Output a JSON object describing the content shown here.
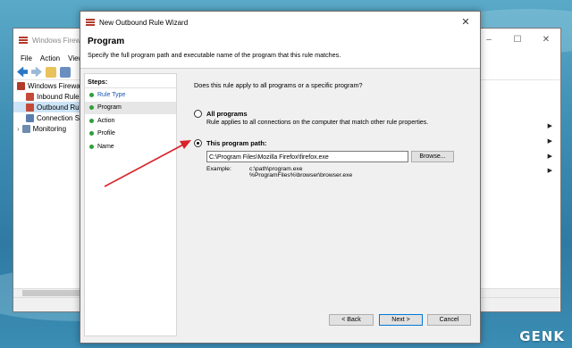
{
  "colors": {
    "accent": "#0078d7",
    "link": "#1a56b3",
    "step_dot": "#2f9e3a",
    "arrow": "#d9232a"
  },
  "background_window": {
    "title": "Windows Firewall",
    "menu": [
      "File",
      "Action",
      "View"
    ],
    "tree": [
      "Windows Firewall",
      "Inbound Rules",
      "Outbound Rules",
      "Connection Se",
      "Monitoring"
    ]
  },
  "wizard": {
    "title": "New Outbound Rule Wizard",
    "close_glyph": "✕",
    "header_title": "Program",
    "header_desc": "Specify the full program path and executable name of the program that this rule matches.",
    "steps_label": "Steps:",
    "steps": [
      "Rule Type",
      "Program",
      "Action",
      "Profile",
      "Name"
    ],
    "question": "Does this rule apply to all programs or a specific program?",
    "option_all_label": "All programs",
    "option_all_desc": "Rule applies to all connections on the computer that match other rule properties.",
    "option_path_label": "This program path:",
    "path_value": "C:\\Program Files\\Mozilla Firefox\\firefox.exe",
    "browse_label": "Browse...",
    "example_label": "Example:",
    "example_line1": "c:\\path\\program.exe",
    "example_line2": "%ProgramFiles%\\browser\\browser.exe",
    "back_label": "< Back",
    "next_label": "Next >",
    "cancel_label": "Cancel"
  },
  "logo": "GENK"
}
